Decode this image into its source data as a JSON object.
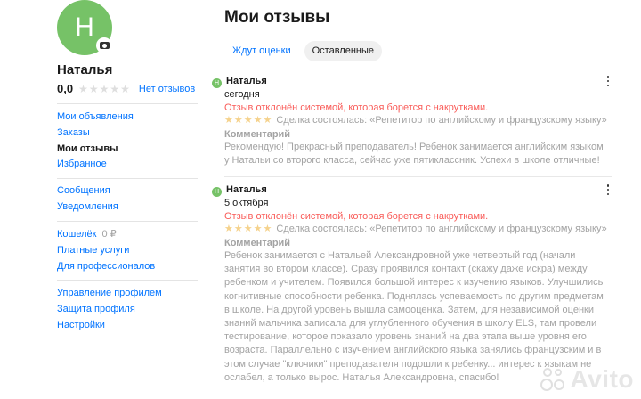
{
  "profile": {
    "avatar_letter": "Н",
    "name": "Наталья",
    "rating": "0,0",
    "rating_stars": 0,
    "no_reviews": "Нет отзывов"
  },
  "menu": {
    "group1": [
      "Мои объявления",
      "Заказы",
      "Мои отзывы",
      "Избранное"
    ],
    "group2": [
      "Сообщения",
      "Уведомления"
    ],
    "wallet": "Кошелёк",
    "wallet_amount": "0 ₽",
    "group3": [
      "Платные услуги",
      "Для профессионалов"
    ],
    "group4": [
      "Управление профилем",
      "Защита профиля",
      "Настройки"
    ]
  },
  "main": {
    "title": "Мои отзывы",
    "tabs": [
      {
        "label": "Ждут оценки",
        "active": false
      },
      {
        "label": "Оставленные",
        "active": true
      }
    ]
  },
  "reviews": [
    {
      "avatar_letter": "Н",
      "author": "Наталья",
      "date": "сегодня",
      "status": "Отзыв отклонён системой, которая борется с накрутками.",
      "stars": 5,
      "deal": "Сделка состоялась: «Репетитор по английскому и французскому языку»",
      "comment_label": "Комментарий",
      "text": "Рекомендую! Прекрасный преподаватель! Ребенок занимается английским языком у Натальи со второго класса, сейчас уже пятиклассник. Успехи в школе отличные!"
    },
    {
      "avatar_letter": "Н",
      "author": "Наталья",
      "date": "5 октября",
      "status": "Отзыв отклонён системой, которая борется с накрутками.",
      "stars": 5,
      "deal": "Сделка состоялась: «Репетитор по английскому и французскому языку»",
      "comment_label": "Комментарий",
      "text": "Ребенок занимается с Натальей Александровной уже четвертый год (начали занятия во втором классе). Сразу проявился контакт (скажу даже искра) между ребенком и учителем. Появился большой интерес к изучению языков. Улучшились когнитивные способности ребенка. Поднялась успеваемость по другим предметам в школе. На другой уровень вышла самооценка. Затем, для независимой оценки знаний мальчика записала для углубленного обучения в школу ELS, там провели тестирование, которое показало уровень знаний на два этапа выше уровня его возраста. Параллельно с изучением английского языка занялись французским и в этом случае \"ключики\" преподавателя подошли к ребенку... интерес к языкам не ослабел, а только вырос. Наталья Александровна, спасибо!"
    }
  ],
  "watermark": "Avito",
  "colors": {
    "accent": "#0073ff",
    "avatar": "#76c267",
    "status": "#f83f3b",
    "star": "#ffb021"
  }
}
